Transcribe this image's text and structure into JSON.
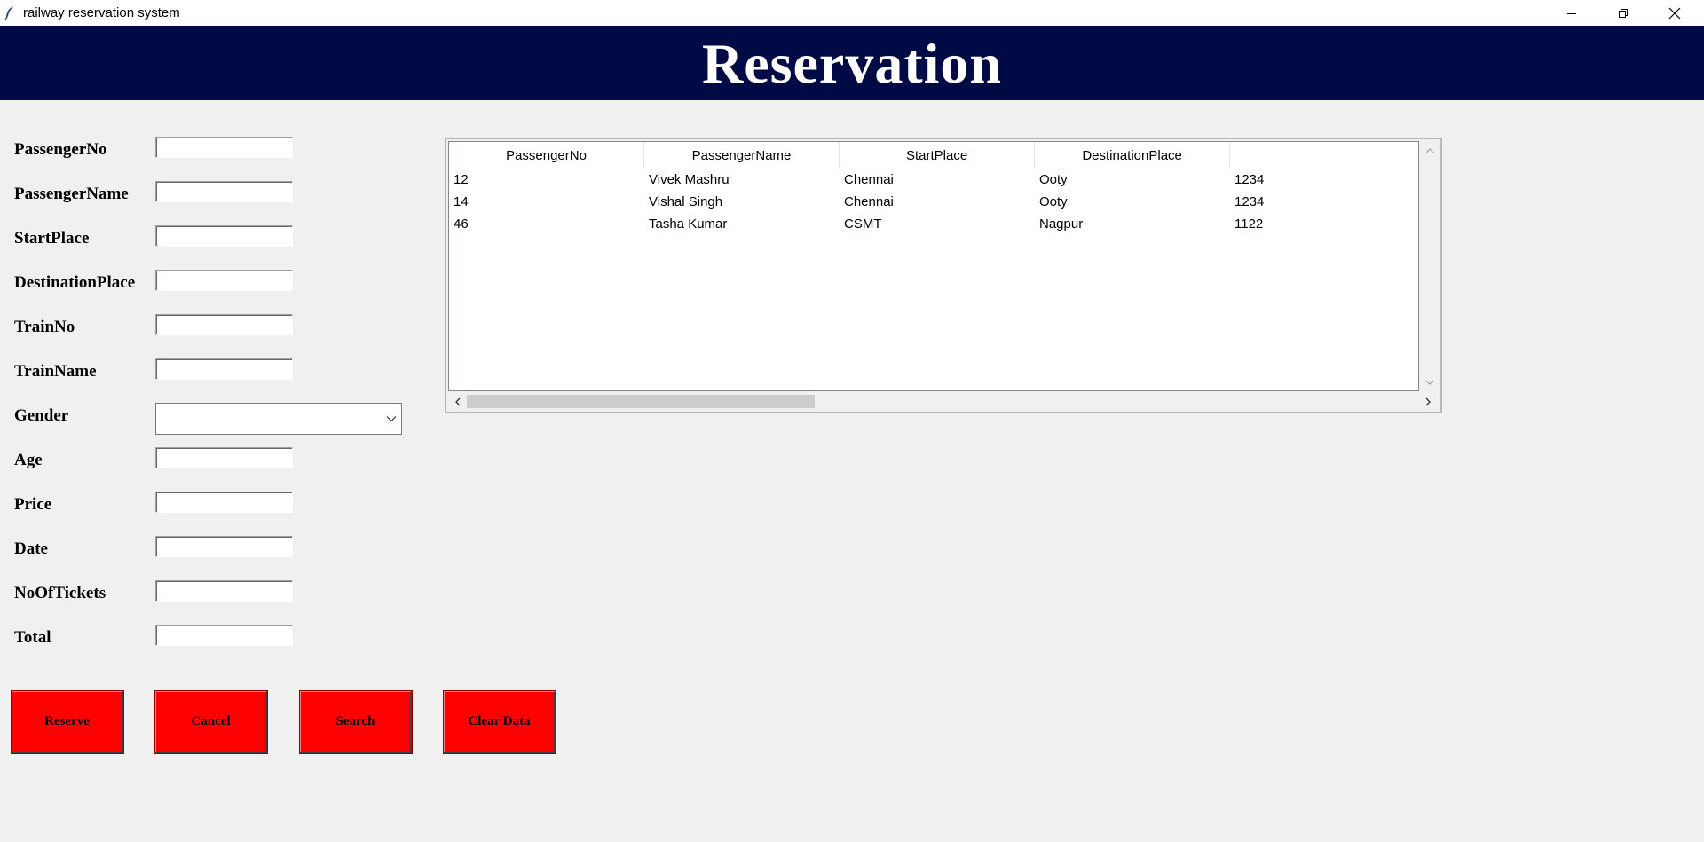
{
  "window": {
    "title": "railway reservation system",
    "controls": [
      "minimize-icon",
      "restore-icon",
      "close-icon"
    ]
  },
  "header": {
    "title": "Reservation",
    "background": "#000b45"
  },
  "form": {
    "fields": [
      {
        "label": "PassengerNo",
        "value": ""
      },
      {
        "label": "PassengerName",
        "value": ""
      },
      {
        "label": "StartPlace",
        "value": ""
      },
      {
        "label": "DestinationPlace",
        "value": ""
      },
      {
        "label": "TrainNo",
        "value": ""
      },
      {
        "label": "TrainName",
        "value": ""
      },
      {
        "label": "Gender",
        "value": ""
      },
      {
        "label": "Age",
        "value": ""
      },
      {
        "label": "Price",
        "value": ""
      },
      {
        "label": "Date",
        "value": ""
      },
      {
        "label": "NoOfTickets",
        "value": ""
      },
      {
        "label": "Total",
        "value": ""
      }
    ]
  },
  "table": {
    "columns": [
      "PassengerNo",
      "PassengerName",
      "StartPlace",
      "DestinationPlace",
      ""
    ],
    "rows": [
      [
        "12",
        "Vivek Mashru",
        "Chennai",
        "Ooty",
        "1234"
      ],
      [
        "14",
        "Vishal Singh",
        "Chennai",
        "Ooty",
        "1234"
      ],
      [
        "46",
        "Tasha Kumar",
        "CSMT",
        "Nagpur",
        "1122"
      ]
    ]
  },
  "buttons": {
    "reserve": "Reserve",
    "cancel": "Cancel",
    "search": "Search",
    "clear": "Clear Data",
    "color": "#ff0000"
  }
}
